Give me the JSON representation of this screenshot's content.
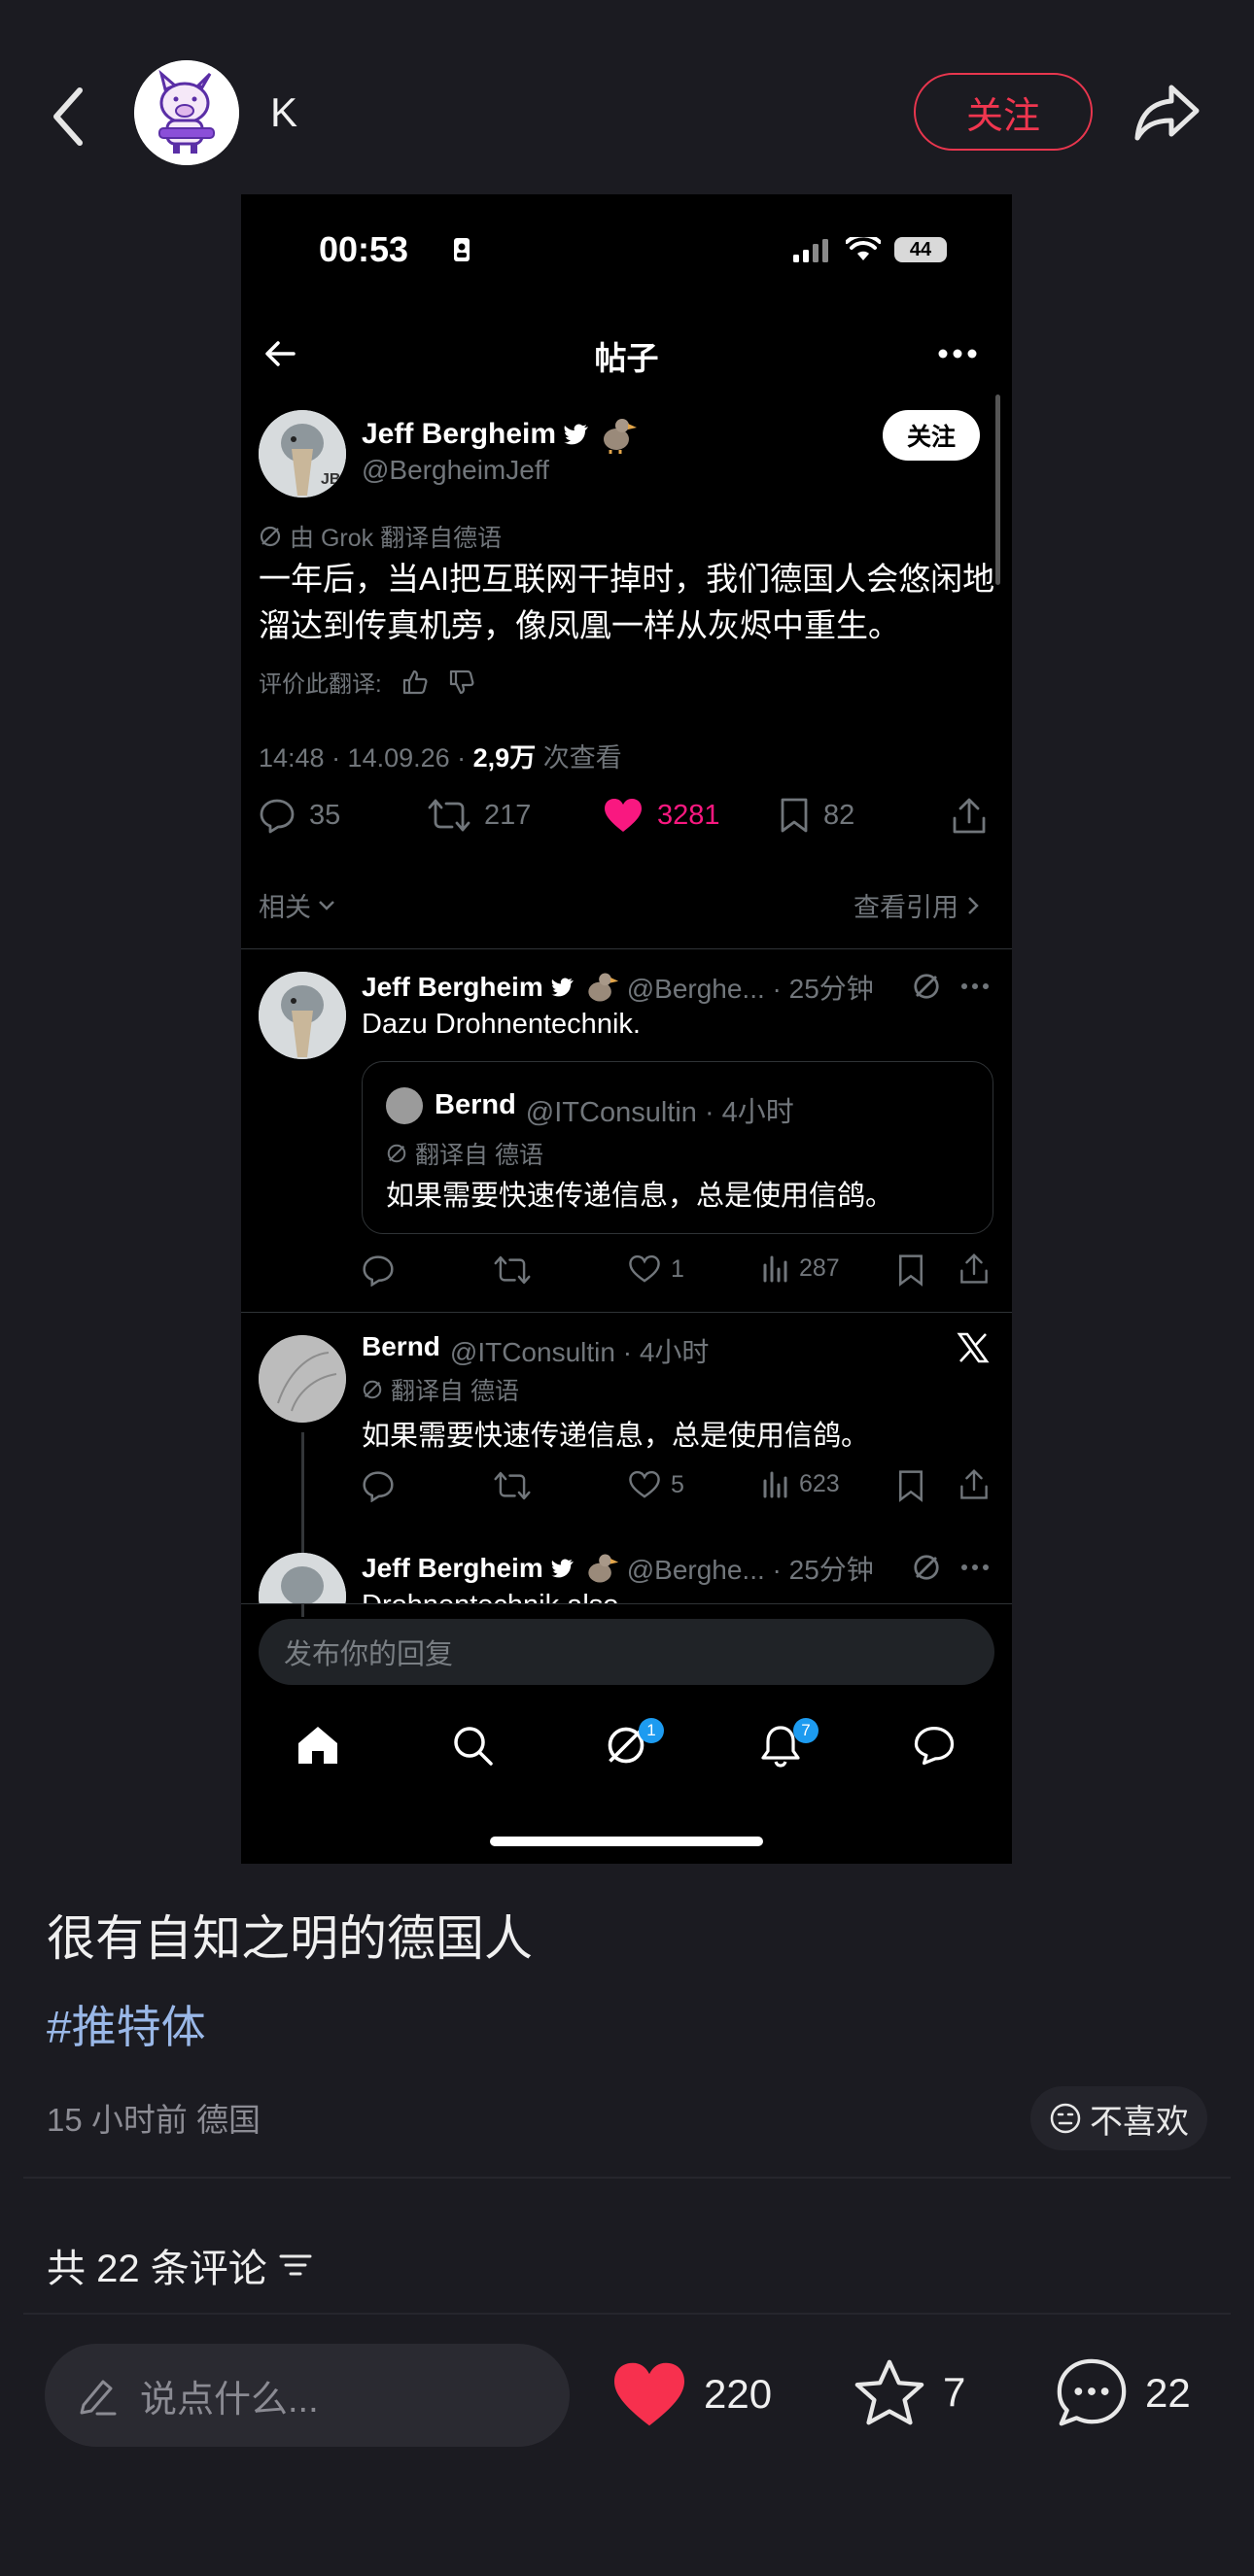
{
  "header": {
    "username": "K",
    "follow_label": "关注"
  },
  "screenshot": {
    "status_time": "00:53",
    "battery": "44",
    "nav_title": "帖子",
    "tweet": {
      "author_name": "Jeff Bergheim",
      "author_handle": "@BergheimJeff",
      "avatar_initials": "JB",
      "follow_label": "关注",
      "translation_note": "由 Grok 翻译自德语",
      "body": "一年后，当AI把互联网干掉时，我们德国人会悠闲地溜达到传真机旁，像凤凰一样从灰烬中重生。",
      "rate_translation": "评价此翻译:",
      "meta_time": "14:48 · 14.09.26 · ",
      "views_value": "2,9万",
      "views_label": " 次查看",
      "replies": "35",
      "retweets": "217",
      "likes": "3281",
      "bookmarks": "82",
      "related_label": "相关",
      "view_quotes_label": "查看引用"
    },
    "reply1": {
      "author_name": "Jeff Bergheim",
      "handle_time": "@Berghe... · 25分钟",
      "text": "Dazu Drohnentechnik.",
      "quote_name": "Bernd",
      "quote_handle_time": "@ITConsultin · 4小时",
      "quote_translation": "翻译自 德语",
      "quote_text": "如果需要快速传递信息，总是使用信鸽。",
      "likes": "1",
      "views": "287"
    },
    "reply2": {
      "author_name": "Bernd",
      "handle_time": "@ITConsultin · 4小时",
      "translation": "翻译自 德语",
      "text": "如果需要快速传递信息，总是使用信鸽。",
      "likes": "5",
      "views": "623"
    },
    "reply3": {
      "author_name": "Jeff Bergheim",
      "handle_time": "@Berghe... · 25分钟",
      "text": "Drohnentechnik also"
    },
    "reply_placeholder": "发布你的回复",
    "badges": {
      "grok": "1",
      "notifications": "7"
    }
  },
  "post": {
    "title": "很有自知之明的德国人",
    "hashtag": "#推特体",
    "meta": "15 小时前  德国",
    "dislike_label": "不喜欢",
    "comment_count_label": "共 22 条评论"
  },
  "bottom_bar": {
    "comment_placeholder": "说点什么...",
    "likes": "220",
    "favorites": "7",
    "comments": "22"
  },
  "colors": {
    "background": "#1b1b21",
    "follow_red": "#e8364e",
    "like_red": "#f7304e",
    "x_like_pink": "#f91880",
    "hashtag_blue": "#9ab8e8",
    "x_blue": "#1d9bf0"
  }
}
